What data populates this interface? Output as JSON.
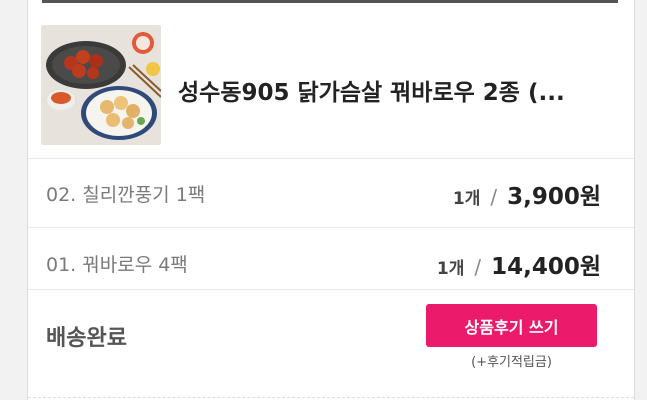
{
  "product": {
    "title": "성수동905 닭가슴살 꿔바로우 2종 (...",
    "image_alt": "닭가슴살 꿔바로우 상품 이미지"
  },
  "options": [
    {
      "name": "02. 칠리깐풍기 1팩",
      "qty": "1개",
      "separator": "/",
      "price": "3,900원"
    },
    {
      "name": "01. 꿔바로우 4팩",
      "qty": "1개",
      "separator": "/",
      "price": "14,400원"
    }
  ],
  "order": {
    "status": "배송완료",
    "review_button_label": "상품후기 쓰기",
    "review_reward_note": "(+후기적립금)"
  },
  "colors": {
    "accent": "#ec1a6a",
    "title_text": "#222222",
    "muted_text": "#7a7a7a",
    "page_bg": "#f2f2f2"
  },
  "icons": {
    "thumbnail": "product-photo"
  }
}
